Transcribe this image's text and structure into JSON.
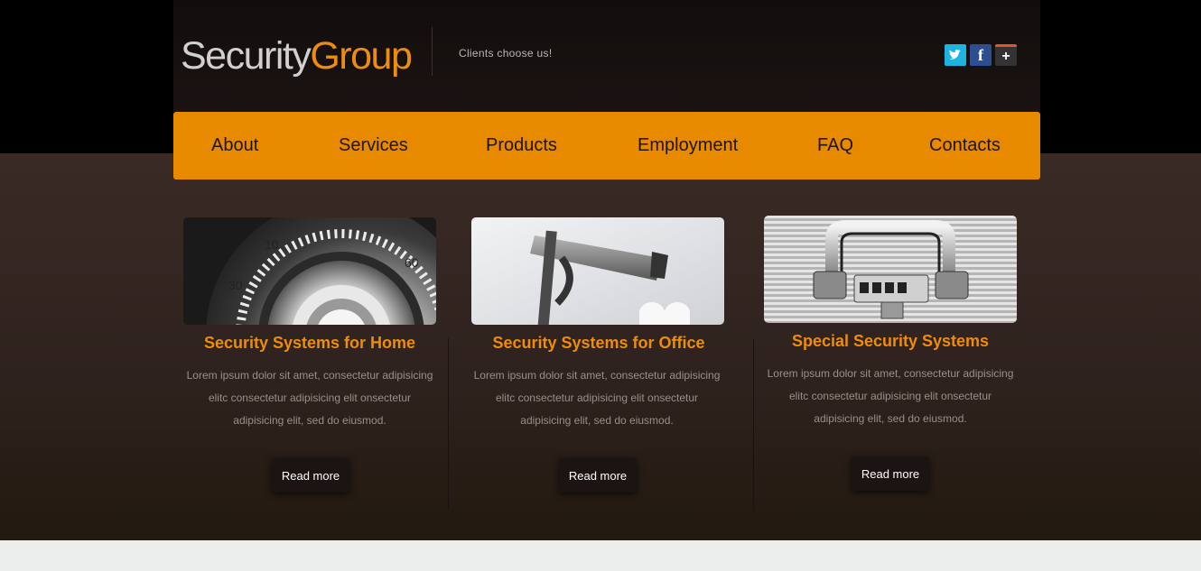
{
  "logo": {
    "part1": "Security",
    "part2": "Group"
  },
  "tagline": "Clients choose us!",
  "social": {
    "twitter": "twitter-icon",
    "facebook": "facebook-icon",
    "plus": "google-plus-icon"
  },
  "nav": [
    "About",
    "Services",
    "Products",
    "Employment",
    "FAQ",
    "Contacts"
  ],
  "cards": [
    {
      "title": "Security Systems for Home",
      "image": "safe-dial-image",
      "lines": [
        "Lorem ipsum dolor sit amet, consectetur adipisicing",
        "elitc consectetur adipisicing elit onsectetur",
        "adipisicing elit, sed do eiusmod."
      ],
      "button": "Read more"
    },
    {
      "title": "Security Systems for Office",
      "image": "security-camera-image",
      "lines": [
        "Lorem ipsum dolor sit amet, consectetur adipisicing",
        "elitc consectetur adipisicing elit onsectetur",
        "adipisicing elit, sed do eiusmod."
      ],
      "button": "Read more"
    },
    {
      "title": "Special Security Systems",
      "image": "briefcase-lock-image",
      "lines": [
        "Lorem ipsum dolor sit amet, consectetur adipisicing",
        "elitc consectetur adipisicing elit onsectetur",
        "adipisicing elit, sed do eiusmod."
      ],
      "button": "Read more"
    }
  ],
  "colors": {
    "accent": "#e88a00",
    "title": "#ee8c0e",
    "dark": "#1b1413"
  }
}
